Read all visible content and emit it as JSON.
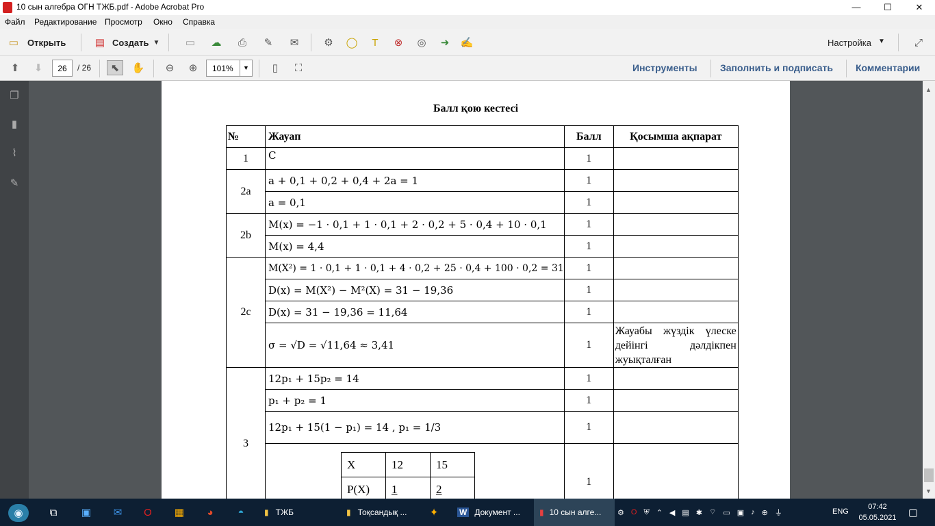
{
  "window": {
    "title": "10 сын алгебра ОГН ТЖБ.pdf - Adobe Acrobat Pro",
    "minimize": "—",
    "maximize": "☐",
    "close": "✕"
  },
  "menu": [
    "Файл",
    "Редактирование",
    "Просмотр",
    "Окно",
    "Справка"
  ],
  "toolbar": {
    "open_label": "Открыть",
    "create_label": "Создать",
    "customize_label": "Настройка"
  },
  "nav": {
    "page_current": "26",
    "page_total": "/ 26",
    "zoom": "101%",
    "tools_label": "Инструменты",
    "fill_sign_label": "Заполнить и подписать",
    "comments_label": "Комментарии"
  },
  "document": {
    "title": "Балл қою кестесі",
    "headers": [
      "№",
      "Жауап",
      "Балл",
      "Қосымша ақпарат"
    ],
    "rows": [
      {
        "no": "1",
        "answer": "C",
        "score": "1",
        "info": ""
      },
      {
        "no": "2a",
        "answer": "a + 0,1 + 0,2 + 0,4 + 2a = 1",
        "score": "1",
        "info": ""
      },
      {
        "no": "",
        "answer": "a = 0,1",
        "score": "1",
        "info": ""
      },
      {
        "no": "2b",
        "answer": "M(x) = −1 · 0,1 + 1 · 0,1 + 2 · 0,2 + 5 · 0,4 + 10 · 0,1",
        "score": "1",
        "info": ""
      },
      {
        "no": "",
        "answer": "M(x) = 4,4",
        "score": "1",
        "info": ""
      },
      {
        "no": "2c",
        "answer": "M(X²) = 1 · 0,1 + 1 · 0,1 + 4 · 0,2 + 25 · 0,4 + 100 · 0,2 = 31",
        "score": "1",
        "info": ""
      },
      {
        "no": "",
        "answer": "D(x) = M(X²) − M²(X) = 31 − 19,36",
        "score": "1",
        "info": ""
      },
      {
        "no": "",
        "answer": "D(x) = 31 − 19,36 = 11,64",
        "score": "1",
        "info": ""
      },
      {
        "no": "",
        "answer": "σ = √D = √11,64 ≈ 3,41",
        "score": "1",
        "info": "Жауабы жүздік үлеске дейінгі дәлдікпен жуықталған"
      },
      {
        "no": "3",
        "answer": "12p₁ + 15p₂ = 14",
        "score": "1",
        "info": ""
      },
      {
        "no": "",
        "answer": "p₁ + p₂ = 1",
        "score": "1",
        "info": ""
      },
      {
        "no": "",
        "answer": "12p₁ + 15(1 − p₁) = 14 ,  p₁ = 1/3",
        "score": "1",
        "info": ""
      },
      {
        "no": "",
        "answer": "",
        "score": "1",
        "info": ""
      }
    ],
    "dist_table": {
      "row1": [
        "X",
        "12",
        "15"
      ],
      "row2": [
        "P(X)",
        "1",
        "2"
      ]
    }
  },
  "taskbar": {
    "apps": [
      "ТЖБ",
      "Тоқсандық ...",
      "Документ ...",
      "10 сын алге..."
    ],
    "lang": "ENG",
    "time": "07:42",
    "date": "05.05.2021"
  }
}
